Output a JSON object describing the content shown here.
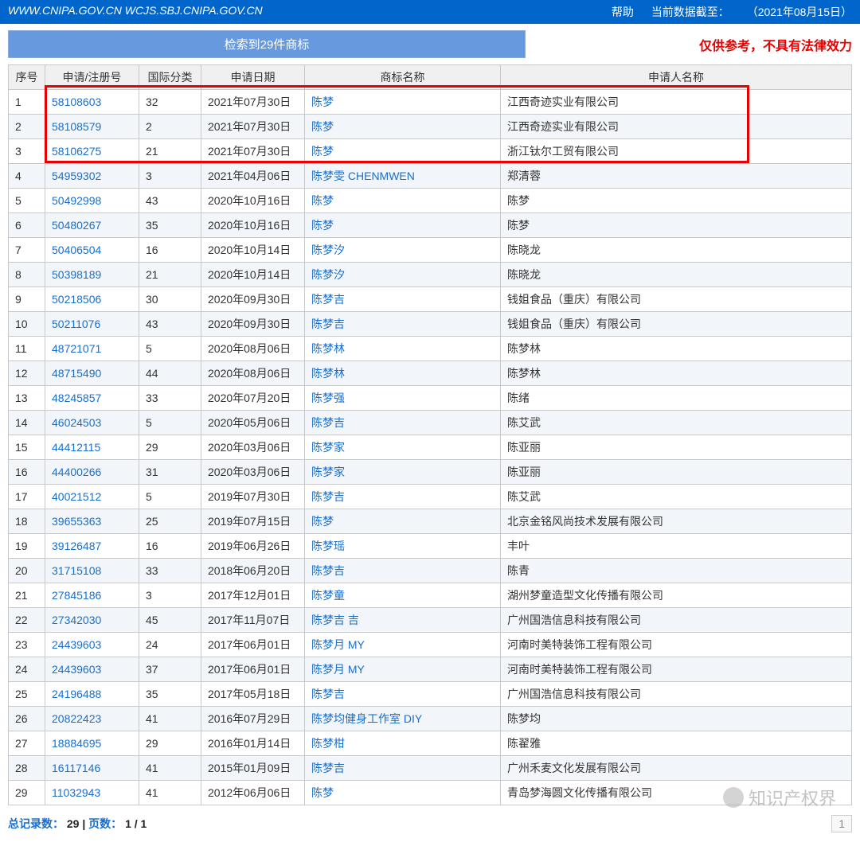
{
  "topbar": {
    "url": "WWW.CNIPA.GOV.CN WCJS.SBJ.CNIPA.GOV.CN",
    "help": "帮助",
    "data_cutoff_label": "当前数据截至：",
    "data_cutoff_value": "（2021年08月15日）"
  },
  "header": {
    "result_banner": "检索到29件商标",
    "disclaimer": "仅供参考，不具有法律效力"
  },
  "columns": {
    "seq": "序号",
    "reg": "申请/注册号",
    "cls": "国际分类",
    "date": "申请日期",
    "tmname": "商标名称",
    "applicant": "申请人名称"
  },
  "rows": [
    {
      "seq": "1",
      "reg": "58108603",
      "cls": "32",
      "date": "2021年07月30日",
      "tmname": "陈梦",
      "applicant": "江西奇迹实业有限公司"
    },
    {
      "seq": "2",
      "reg": "58108579",
      "cls": "2",
      "date": "2021年07月30日",
      "tmname": "陈梦",
      "applicant": "江西奇迹实业有限公司"
    },
    {
      "seq": "3",
      "reg": "58106275",
      "cls": "21",
      "date": "2021年07月30日",
      "tmname": "陈梦",
      "applicant": "浙江钛尔工贸有限公司"
    },
    {
      "seq": "4",
      "reg": "54959302",
      "cls": "3",
      "date": "2021年04月06日",
      "tmname": "陈梦雯 CHENMWEN",
      "applicant": "郑清蓉"
    },
    {
      "seq": "5",
      "reg": "50492998",
      "cls": "43",
      "date": "2020年10月16日",
      "tmname": "陈梦",
      "applicant": "陈梦"
    },
    {
      "seq": "6",
      "reg": "50480267",
      "cls": "35",
      "date": "2020年10月16日",
      "tmname": "陈梦",
      "applicant": "陈梦"
    },
    {
      "seq": "7",
      "reg": "50406504",
      "cls": "16",
      "date": "2020年10月14日",
      "tmname": "陈梦汐",
      "applicant": "陈晓龙"
    },
    {
      "seq": "8",
      "reg": "50398189",
      "cls": "21",
      "date": "2020年10月14日",
      "tmname": "陈梦汐",
      "applicant": "陈晓龙"
    },
    {
      "seq": "9",
      "reg": "50218506",
      "cls": "30",
      "date": "2020年09月30日",
      "tmname": "陈梦吉",
      "applicant": "钱姐食品（重庆）有限公司"
    },
    {
      "seq": "10",
      "reg": "50211076",
      "cls": "43",
      "date": "2020年09月30日",
      "tmname": "陈梦吉",
      "applicant": "钱姐食品（重庆）有限公司"
    },
    {
      "seq": "11",
      "reg": "48721071",
      "cls": "5",
      "date": "2020年08月06日",
      "tmname": "陈梦林",
      "applicant": "陈梦林"
    },
    {
      "seq": "12",
      "reg": "48715490",
      "cls": "44",
      "date": "2020年08月06日",
      "tmname": "陈梦林",
      "applicant": "陈梦林"
    },
    {
      "seq": "13",
      "reg": "48245857",
      "cls": "33",
      "date": "2020年07月20日",
      "tmname": "陈梦强",
      "applicant": "陈绪"
    },
    {
      "seq": "14",
      "reg": "46024503",
      "cls": "5",
      "date": "2020年05月06日",
      "tmname": "陈梦吉",
      "applicant": "陈艾武"
    },
    {
      "seq": "15",
      "reg": "44412115",
      "cls": "29",
      "date": "2020年03月06日",
      "tmname": "陈梦家",
      "applicant": "陈亚丽"
    },
    {
      "seq": "16",
      "reg": "44400266",
      "cls": "31",
      "date": "2020年03月06日",
      "tmname": "陈梦家",
      "applicant": "陈亚丽"
    },
    {
      "seq": "17",
      "reg": "40021512",
      "cls": "5",
      "date": "2019年07月30日",
      "tmname": "陈梦吉",
      "applicant": "陈艾武"
    },
    {
      "seq": "18",
      "reg": "39655363",
      "cls": "25",
      "date": "2019年07月15日",
      "tmname": "陈梦",
      "applicant": "北京金铭风尚技术发展有限公司"
    },
    {
      "seq": "19",
      "reg": "39126487",
      "cls": "16",
      "date": "2019年06月26日",
      "tmname": "陈梦瑶",
      "applicant": "丰叶"
    },
    {
      "seq": "20",
      "reg": "31715108",
      "cls": "33",
      "date": "2018年06月20日",
      "tmname": "陈梦吉",
      "applicant": "陈青"
    },
    {
      "seq": "21",
      "reg": "27845186",
      "cls": "3",
      "date": "2017年12月01日",
      "tmname": "陈梦童",
      "applicant": "湖州梦童造型文化传播有限公司"
    },
    {
      "seq": "22",
      "reg": "27342030",
      "cls": "45",
      "date": "2017年11月07日",
      "tmname": "陈梦吉 吉",
      "applicant": "广州国浩信息科技有限公司"
    },
    {
      "seq": "23",
      "reg": "24439603",
      "cls": "24",
      "date": "2017年06月01日",
      "tmname": "陈梦月 MY",
      "applicant": "河南时美特装饰工程有限公司"
    },
    {
      "seq": "24",
      "reg": "24439603",
      "cls": "37",
      "date": "2017年06月01日",
      "tmname": "陈梦月 MY",
      "applicant": "河南时美特装饰工程有限公司"
    },
    {
      "seq": "25",
      "reg": "24196488",
      "cls": "35",
      "date": "2017年05月18日",
      "tmname": "陈梦吉",
      "applicant": "广州国浩信息科技有限公司"
    },
    {
      "seq": "26",
      "reg": "20822423",
      "cls": "41",
      "date": "2016年07月29日",
      "tmname": "陈梦均健身工作室 DIY",
      "applicant": "陈梦均"
    },
    {
      "seq": "27",
      "reg": "18884695",
      "cls": "29",
      "date": "2016年01月14日",
      "tmname": "陈梦柑",
      "applicant": "陈翟雅"
    },
    {
      "seq": "28",
      "reg": "16117146",
      "cls": "41",
      "date": "2015年01月09日",
      "tmname": "陈梦吉",
      "applicant": "广州禾麦文化发展有限公司"
    },
    {
      "seq": "29",
      "reg": "11032943",
      "cls": "41",
      "date": "2012年06月06日",
      "tmname": "陈梦",
      "applicant": "青岛梦海圆文化传播有限公司"
    }
  ],
  "footer": {
    "total_label": "总记录数：",
    "total_value": "29",
    "sep": " | ",
    "pages_label": "页数：",
    "pages_value": "1 / 1",
    "page_current": "1"
  },
  "watermark": {
    "text": "知识产权界"
  }
}
